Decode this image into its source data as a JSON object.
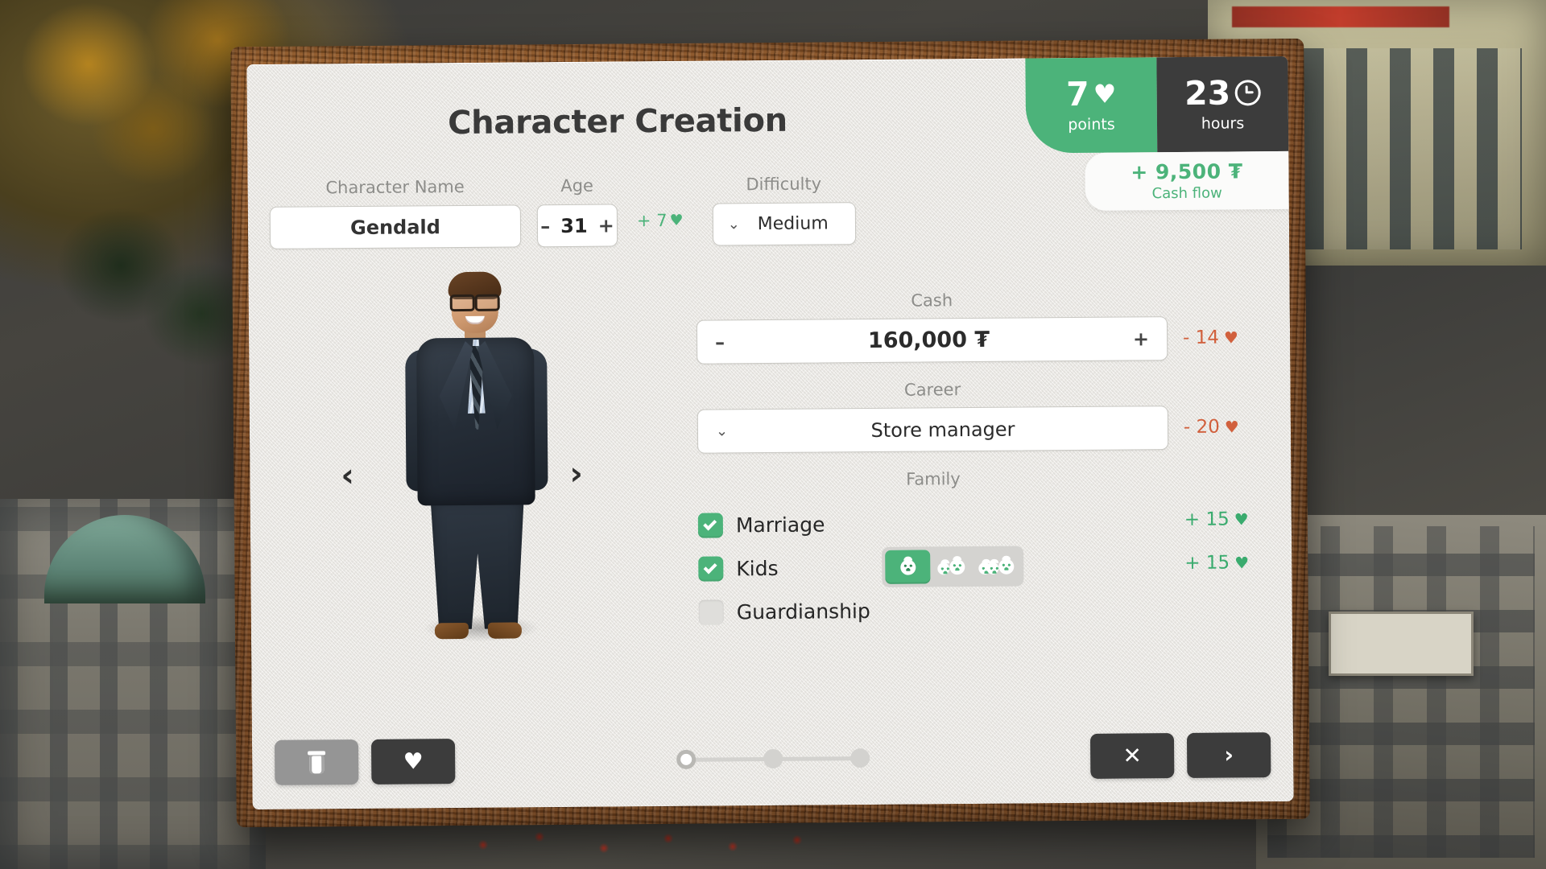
{
  "window": {
    "title": "Character Creation"
  },
  "hud": {
    "points": {
      "value": "7",
      "label": "points",
      "icon": "heart-icon",
      "color": "#4cb37a"
    },
    "hours": {
      "value": "23",
      "label": "hours",
      "icon": "clock-icon",
      "color": "#3c3c3c"
    },
    "cashflow": {
      "value": "+ 9,500 ₮",
      "label": "Cash flow",
      "color": "#4cb37a"
    }
  },
  "form": {
    "name": {
      "label": "Character Name",
      "value": "Gendald",
      "placeholder": "Character Name"
    },
    "age": {
      "label": "Age",
      "value": "31",
      "minus": "–",
      "plus": "+",
      "bonus": "+ 7",
      "bonus_icon": "heart-icon",
      "bonus_color": "#4cb37a"
    },
    "difficulty": {
      "label": "Difficulty",
      "value": "Medium",
      "options": [
        "Medium"
      ]
    },
    "cash": {
      "label": "Cash",
      "value": "160,000 ₮",
      "minus": "–",
      "plus": "+",
      "modifier": "- 14",
      "modifier_color": "#d1603d"
    },
    "career": {
      "label": "Career",
      "value": "Store manager",
      "options": [
        "Store manager"
      ],
      "modifier": "- 20",
      "modifier_color": "#d1603d"
    }
  },
  "family": {
    "label": "Family",
    "items": [
      {
        "label": "Marriage",
        "checked": true,
        "modifier": "+ 15",
        "modifier_color": "#3aab6e"
      },
      {
        "label": "Kids",
        "checked": true,
        "modifier": "+ 15",
        "modifier_color": "#3aab6e"
      },
      {
        "label": "Guardianship",
        "checked": false,
        "modifier": ""
      }
    ],
    "kids_options": [
      "1",
      "2",
      "3"
    ],
    "kids_selected": 0
  },
  "character": {
    "prev_arrow": "‹",
    "next_arrow": "›"
  },
  "footer": {
    "delete_icon": "trash-icon",
    "favorite_icon": "heart-icon",
    "favorite_glyph": "♥",
    "close_icon": "close-icon",
    "close_glyph": "✕",
    "next_icon": "chevron-right-icon",
    "next_glyph": "›",
    "steps_total": 3,
    "step_active": 1
  },
  "glyphs": {
    "heart": "♥",
    "chevron_down": "⌄"
  }
}
